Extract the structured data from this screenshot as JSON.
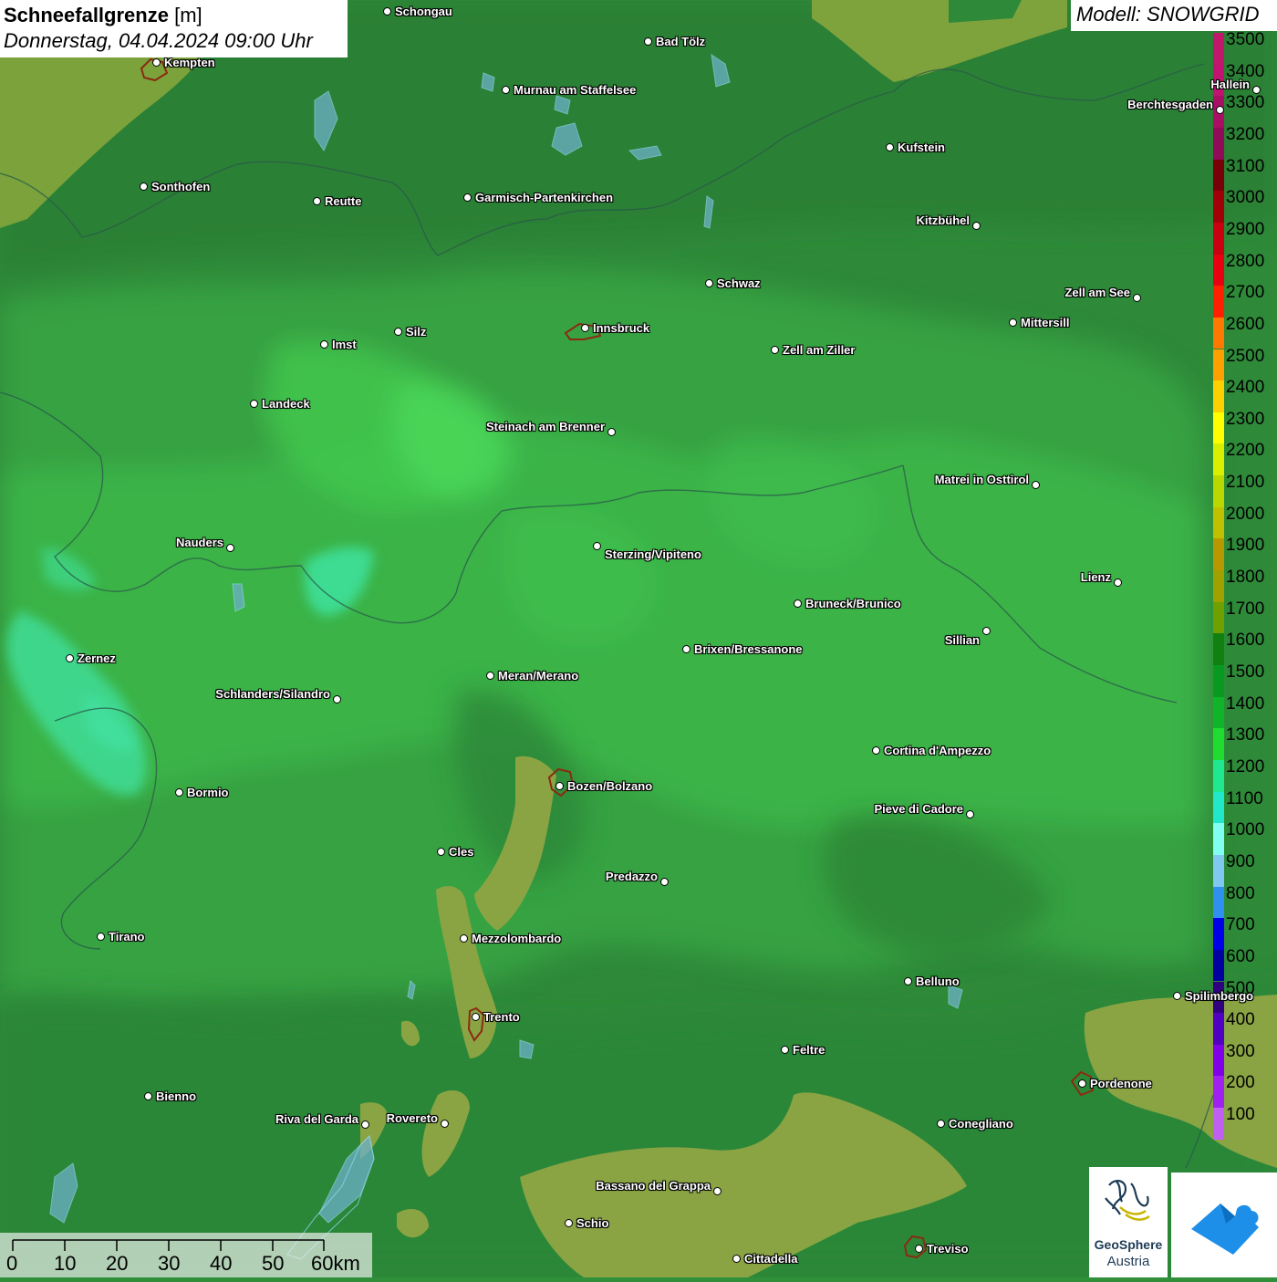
{
  "header": {
    "title_bold": "Schneefallgrenze",
    "title_unit": "[m]",
    "datetime": "Donnerstag, 04.04.2024 09:00 Uhr",
    "model": "Modell: SNOWGRID"
  },
  "legend": {
    "levels": [
      {
        "label": "3500",
        "color": "#c0186a"
      },
      {
        "label": "3400",
        "color": "#c01470"
      },
      {
        "label": "3300",
        "color": "#a81064"
      },
      {
        "label": "3200",
        "color": "#900c58"
      },
      {
        "label": "3100",
        "color": "#780008"
      },
      {
        "label": "3000",
        "color": "#a00008"
      },
      {
        "label": "2900",
        "color": "#c80010"
      },
      {
        "label": "2800",
        "color": "#e60010"
      },
      {
        "label": "2700",
        "color": "#ff2000"
      },
      {
        "label": "2600",
        "color": "#ff7800"
      },
      {
        "label": "2500",
        "color": "#ffa000"
      },
      {
        "label": "2400",
        "color": "#ffd000"
      },
      {
        "label": "2300",
        "color": "#ffff00"
      },
      {
        "label": "2200",
        "color": "#d8f000"
      },
      {
        "label": "2100",
        "color": "#b8d800"
      },
      {
        "label": "2000",
        "color": "#c0c000"
      },
      {
        "label": "1900",
        "color": "#b89800"
      },
      {
        "label": "1800",
        "color": "#a0a000"
      },
      {
        "label": "1700",
        "color": "#70a000"
      },
      {
        "label": "1600",
        "color": "#108010"
      },
      {
        "label": "1500",
        "color": "#089a20"
      },
      {
        "label": "1400",
        "color": "#10b428"
      },
      {
        "label": "1300",
        "color": "#20dc30"
      },
      {
        "label": "1200",
        "color": "#20e890"
      },
      {
        "label": "1100",
        "color": "#20e8c8"
      },
      {
        "label": "1000",
        "color": "#80fff0"
      },
      {
        "label": "900",
        "color": "#80c8f0"
      },
      {
        "label": "800",
        "color": "#3090f0"
      },
      {
        "label": "700",
        "color": "#0000e8"
      },
      {
        "label": "600",
        "color": "#0000a0"
      },
      {
        "label": "500",
        "color": "#300080"
      },
      {
        "label": "400",
        "color": "#5000c0"
      },
      {
        "label": "300",
        "color": "#8000e8"
      },
      {
        "label": "200",
        "color": "#a020f0"
      },
      {
        "label": "100",
        "color": "#c060f0"
      }
    ]
  },
  "cities": [
    {
      "name": "Schongau"
    },
    {
      "name": "Bad Tölz"
    },
    {
      "name": "Kempten"
    },
    {
      "name": "Murnau am Staffelsee"
    },
    {
      "name": "Hallein"
    },
    {
      "name": "Berchtesgaden"
    },
    {
      "name": "Kufstein"
    },
    {
      "name": "Sonthofen"
    },
    {
      "name": "Reutte"
    },
    {
      "name": "Garmisch-Partenkirchen"
    },
    {
      "name": "Kitzbühel"
    },
    {
      "name": "Schwaz"
    },
    {
      "name": "Zell am See"
    },
    {
      "name": "Innsbruck"
    },
    {
      "name": "Mittersill"
    },
    {
      "name": "Silz"
    },
    {
      "name": "Imst"
    },
    {
      "name": "Zell am Ziller"
    },
    {
      "name": "Landeck"
    },
    {
      "name": "Steinach am Brenner"
    },
    {
      "name": "Matrei in Osttirol"
    },
    {
      "name": "Nauders"
    },
    {
      "name": "Sterzing/Vipiteno"
    },
    {
      "name": "Lienz"
    },
    {
      "name": "Bruneck/Brunico"
    },
    {
      "name": "Sillian"
    },
    {
      "name": "Brixen/Bressanone"
    },
    {
      "name": "Zernez"
    },
    {
      "name": "Meran/Merano"
    },
    {
      "name": "Schlanders/Silandro"
    },
    {
      "name": "Cortina d'Ampezzo"
    },
    {
      "name": "Bozen/Bolzano"
    },
    {
      "name": "Bormio"
    },
    {
      "name": "Pieve di Cadore"
    },
    {
      "name": "Cles"
    },
    {
      "name": "Predazzo"
    },
    {
      "name": "Tirano"
    },
    {
      "name": "Mezzolombardo"
    },
    {
      "name": "Belluno"
    },
    {
      "name": "Spilimbergo"
    },
    {
      "name": "Trento"
    },
    {
      "name": "Feltre"
    },
    {
      "name": "Pordenone"
    },
    {
      "name": "Bienno"
    },
    {
      "name": "Riva del Garda"
    },
    {
      "name": "Rovereto"
    },
    {
      "name": "Conegliano"
    },
    {
      "name": "Bassano del Grappa"
    },
    {
      "name": "Schio"
    },
    {
      "name": "Treviso"
    },
    {
      "name": "Cittadella"
    }
  ],
  "scalebar": {
    "labels": [
      "0",
      "10",
      "20",
      "30",
      "40",
      "50",
      "60km"
    ]
  },
  "logos": {
    "geosphere_line1": "GeoSphere",
    "geosphere_line2": "Austria"
  }
}
